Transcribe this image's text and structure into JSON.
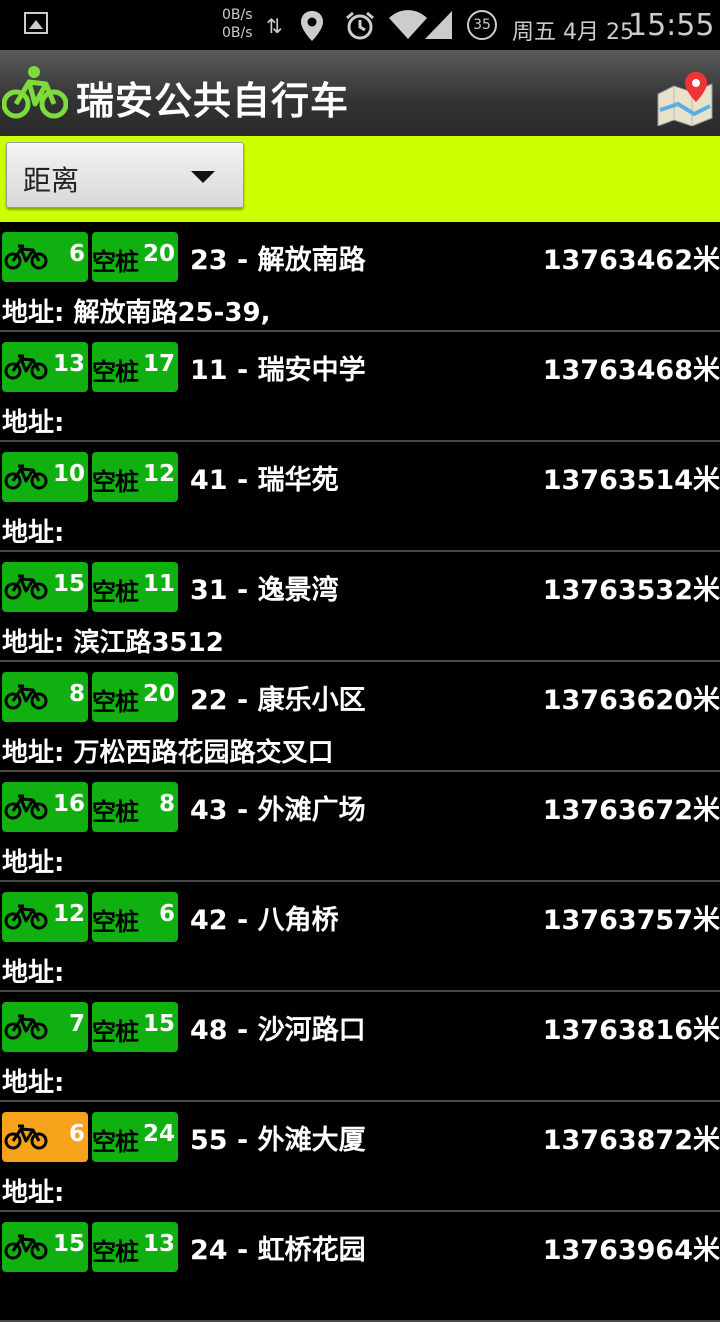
{
  "status_bar": {
    "net_up": "0B/s",
    "net_down": "0B/s",
    "battery": "35",
    "date": "周五 4月 25",
    "time": "15:55",
    "icons": [
      "image-icon",
      "data-arrows-icon",
      "location-icon",
      "alarm-icon",
      "wifi-icon",
      "signal-icon",
      "battery-icon"
    ]
  },
  "header": {
    "title": "瑞安公共自行车",
    "logo_icon": "bicycle-icon",
    "map_icon": "map-pin-icon"
  },
  "filter": {
    "sort_value": "距离"
  },
  "colors": {
    "accent_bar": "#ccff00",
    "badge_ok": "#10b010",
    "badge_warn": "#f7a21b"
  },
  "stations": [
    {
      "bikes": "6",
      "docks": "20",
      "name": "23 - 解放南路",
      "distance": "13763462米",
      "address": "地址: 解放南路25-39,",
      "status": "ok"
    },
    {
      "bikes": "13",
      "docks": "17",
      "name": "11 - 瑞安中学",
      "distance": "13763468米",
      "address": "地址:",
      "status": "ok"
    },
    {
      "bikes": "10",
      "docks": "12",
      "name": "41 - 瑞华苑",
      "distance": "13763514米",
      "address": "地址:",
      "status": "ok"
    },
    {
      "bikes": "15",
      "docks": "11",
      "name": "31 - 逸景湾",
      "distance": "13763532米",
      "address": "地址: 滨江路3512",
      "status": "ok"
    },
    {
      "bikes": "8",
      "docks": "20",
      "name": "22 - 康乐小区",
      "distance": "13763620米",
      "address": "地址: 万松西路花园路交叉口",
      "status": "ok"
    },
    {
      "bikes": "16",
      "docks": "8",
      "name": "43 - 外滩广场",
      "distance": "13763672米",
      "address": "地址:",
      "status": "ok"
    },
    {
      "bikes": "12",
      "docks": "6",
      "name": "42 - 八角桥",
      "distance": "13763757米",
      "address": "地址:",
      "status": "ok"
    },
    {
      "bikes": "7",
      "docks": "15",
      "name": "48 - 沙河路口",
      "distance": "13763816米",
      "address": "地址:",
      "status": "ok"
    },
    {
      "bikes": "6",
      "docks": "24",
      "name": "55 - 外滩大厦",
      "distance": "13763872米",
      "address": "地址:",
      "status": "warn"
    },
    {
      "bikes": "15",
      "docks": "13",
      "name": "24 - 虹桥花园",
      "distance": "13763964米",
      "address": "",
      "status": "ok"
    }
  ],
  "dock_label": "空桩"
}
